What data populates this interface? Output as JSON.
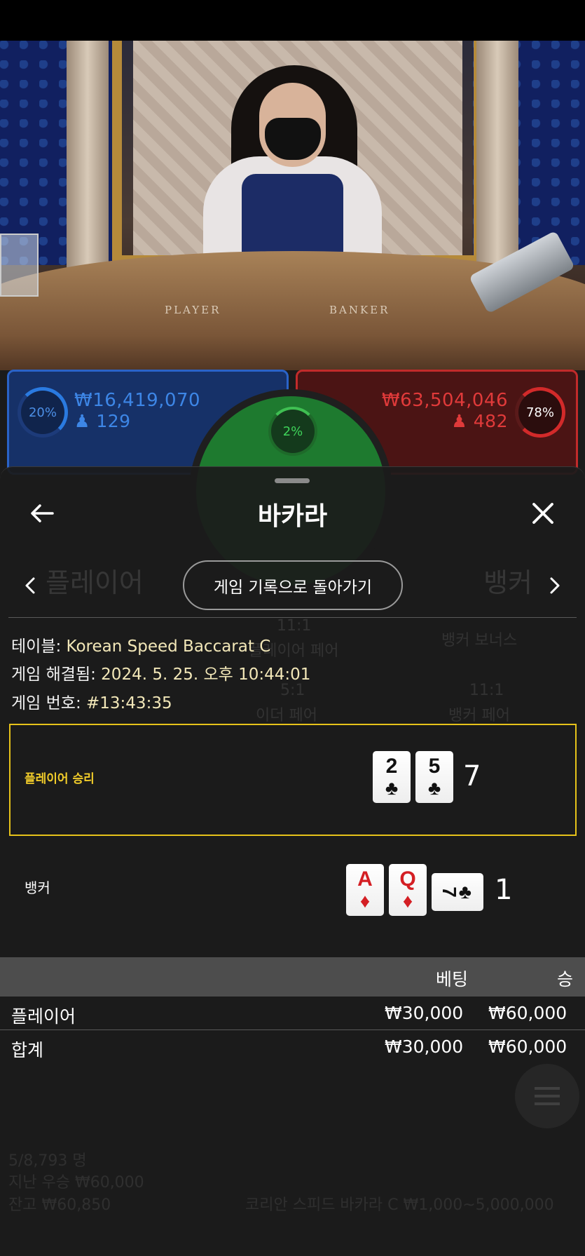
{
  "video": {
    "table_player_label": "PLAYER",
    "table_banker_label": "BANKER"
  },
  "bets": {
    "player": {
      "percent": "20%",
      "amount": "₩16,419,070",
      "players": "129"
    },
    "tie": {
      "percent": "2%"
    },
    "banker": {
      "percent": "78%",
      "amount": "₩63,504,046",
      "players": "482"
    }
  },
  "sheet": {
    "title": "바카라",
    "back_icon": "arrow-left-icon",
    "close_icon": "close-icon",
    "nav_prev_icon": "chevron-left-icon",
    "nav_next_icon": "chevron-right-icon",
    "back_to_history": "게임 기록으로 돌아가기",
    "ghost_left": "플레이어",
    "ghost_right": "뱅커"
  },
  "info": {
    "table_label": "테이블: ",
    "table_value": "Korean Speed Baccarat C",
    "resolved_label": "게임 해결됨: ",
    "resolved_value": "2024. 5. 25. 오후 10:44:01",
    "number_label": "게임 번호: ",
    "number_value": "#13:43:35"
  },
  "result": {
    "winner_label": "플레이어 승리",
    "player_score": "7",
    "player_cards": [
      {
        "rank": "2",
        "suit": "♣",
        "color": "black"
      },
      {
        "rank": "5",
        "suit": "♣",
        "color": "black"
      }
    ],
    "banker_label": "뱅커",
    "banker_score": "1",
    "banker_cards": [
      {
        "rank": "A",
        "suit": "♦",
        "color": "red"
      },
      {
        "rank": "Q",
        "suit": "♦",
        "color": "red"
      },
      {
        "rank": "7",
        "suit": "♣",
        "color": "black",
        "sideways": true
      }
    ]
  },
  "summary": {
    "headers": [
      "베팅",
      "승"
    ],
    "rows": [
      {
        "label": "플레이어",
        "bet": "₩30,000",
        "win": "₩60,000"
      },
      {
        "label": "합계",
        "bet": "₩30,000",
        "win": "₩60,000"
      }
    ]
  },
  "background_ghost": {
    "line1": "5/8,793 명",
    "line2": "지난 우승 ₩60,000",
    "line3": "잔고 ₩60,850",
    "line3_right": "코리안 스피드 바카라 C ₩1,000~5,000,000",
    "mid_a": "11:1",
    "mid_b": "플레이어 페어",
    "mid_c": "뱅커 보너스",
    "mid_d": "5:1",
    "mid_e": "11:1",
    "mid_f": "이더 페어",
    "mid_g": "뱅커 페어"
  },
  "colors": {
    "player_blue": "#2a63c8",
    "banker_red": "#c22b2b",
    "win_gold": "#e6c21a",
    "info_value": "#f2e7b8"
  }
}
